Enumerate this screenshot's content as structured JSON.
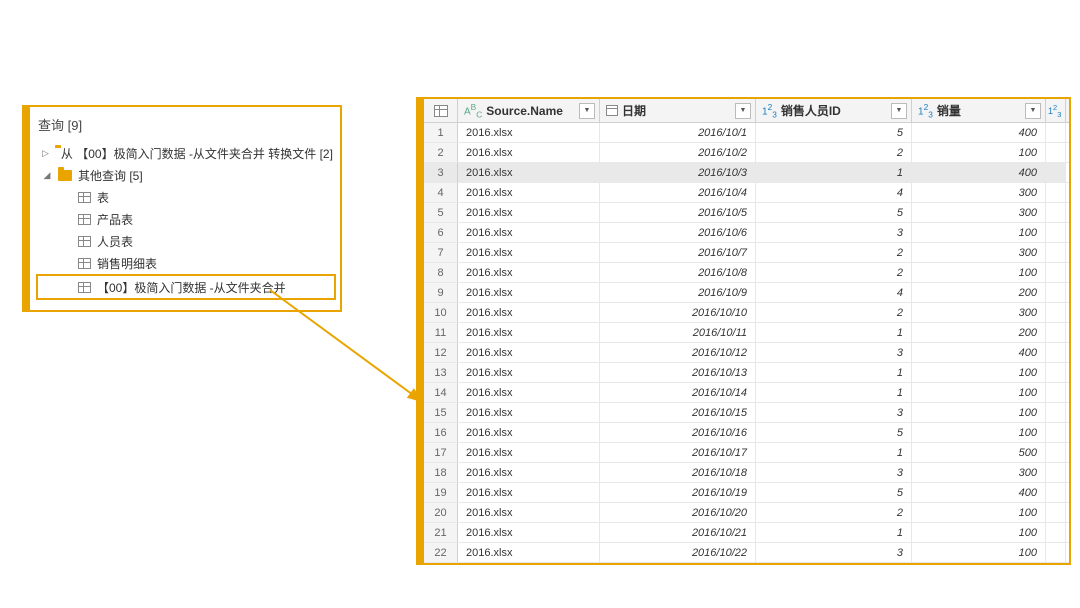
{
  "query_panel": {
    "title": "查询 [9]",
    "nodes": [
      {
        "type": "folder",
        "expanded": false,
        "label": "从 【00】极简入门数据 -从文件夹合并 转换文件 [2]",
        "indent": 0
      },
      {
        "type": "folder",
        "expanded": true,
        "label": "其他查询 [5]",
        "indent": 0
      },
      {
        "type": "table",
        "label": "表",
        "indent": 2
      },
      {
        "type": "table",
        "label": "产品表",
        "indent": 2
      },
      {
        "type": "table",
        "label": "人员表",
        "indent": 2
      },
      {
        "type": "table",
        "label": "销售明细表",
        "indent": 2
      },
      {
        "type": "table",
        "label": "【00】极简入门数据 -从文件夹合并",
        "indent": 2,
        "selected": true
      }
    ]
  },
  "grid": {
    "columns": [
      {
        "type": "text",
        "label": "Source.Name"
      },
      {
        "type": "date",
        "label": "日期"
      },
      {
        "type": "num",
        "label": "销售人员ID"
      },
      {
        "type": "num",
        "label": "销量"
      }
    ],
    "last_col_type": "num",
    "selected_row": 3,
    "rows": [
      {
        "src": "2016.xlsx",
        "date": "2016/10/1",
        "sp": 5,
        "qty": 400
      },
      {
        "src": "2016.xlsx",
        "date": "2016/10/2",
        "sp": 2,
        "qty": 100
      },
      {
        "src": "2016.xlsx",
        "date": "2016/10/3",
        "sp": 1,
        "qty": 400
      },
      {
        "src": "2016.xlsx",
        "date": "2016/10/4",
        "sp": 4,
        "qty": 300
      },
      {
        "src": "2016.xlsx",
        "date": "2016/10/5",
        "sp": 5,
        "qty": 300
      },
      {
        "src": "2016.xlsx",
        "date": "2016/10/6",
        "sp": 3,
        "qty": 100
      },
      {
        "src": "2016.xlsx",
        "date": "2016/10/7",
        "sp": 2,
        "qty": 300
      },
      {
        "src": "2016.xlsx",
        "date": "2016/10/8",
        "sp": 2,
        "qty": 100
      },
      {
        "src": "2016.xlsx",
        "date": "2016/10/9",
        "sp": 4,
        "qty": 200
      },
      {
        "src": "2016.xlsx",
        "date": "2016/10/10",
        "sp": 2,
        "qty": 300
      },
      {
        "src": "2016.xlsx",
        "date": "2016/10/11",
        "sp": 1,
        "qty": 200
      },
      {
        "src": "2016.xlsx",
        "date": "2016/10/12",
        "sp": 3,
        "qty": 400
      },
      {
        "src": "2016.xlsx",
        "date": "2016/10/13",
        "sp": 1,
        "qty": 100
      },
      {
        "src": "2016.xlsx",
        "date": "2016/10/14",
        "sp": 1,
        "qty": 100
      },
      {
        "src": "2016.xlsx",
        "date": "2016/10/15",
        "sp": 3,
        "qty": 100
      },
      {
        "src": "2016.xlsx",
        "date": "2016/10/16",
        "sp": 5,
        "qty": 100
      },
      {
        "src": "2016.xlsx",
        "date": "2016/10/17",
        "sp": 1,
        "qty": 500
      },
      {
        "src": "2016.xlsx",
        "date": "2016/10/18",
        "sp": 3,
        "qty": 300
      },
      {
        "src": "2016.xlsx",
        "date": "2016/10/19",
        "sp": 5,
        "qty": 400
      },
      {
        "src": "2016.xlsx",
        "date": "2016/10/20",
        "sp": 2,
        "qty": 100
      },
      {
        "src": "2016.xlsx",
        "date": "2016/10/21",
        "sp": 1,
        "qty": 100
      },
      {
        "src": "2016.xlsx",
        "date": "2016/10/22",
        "sp": 3,
        "qty": 100
      }
    ]
  }
}
